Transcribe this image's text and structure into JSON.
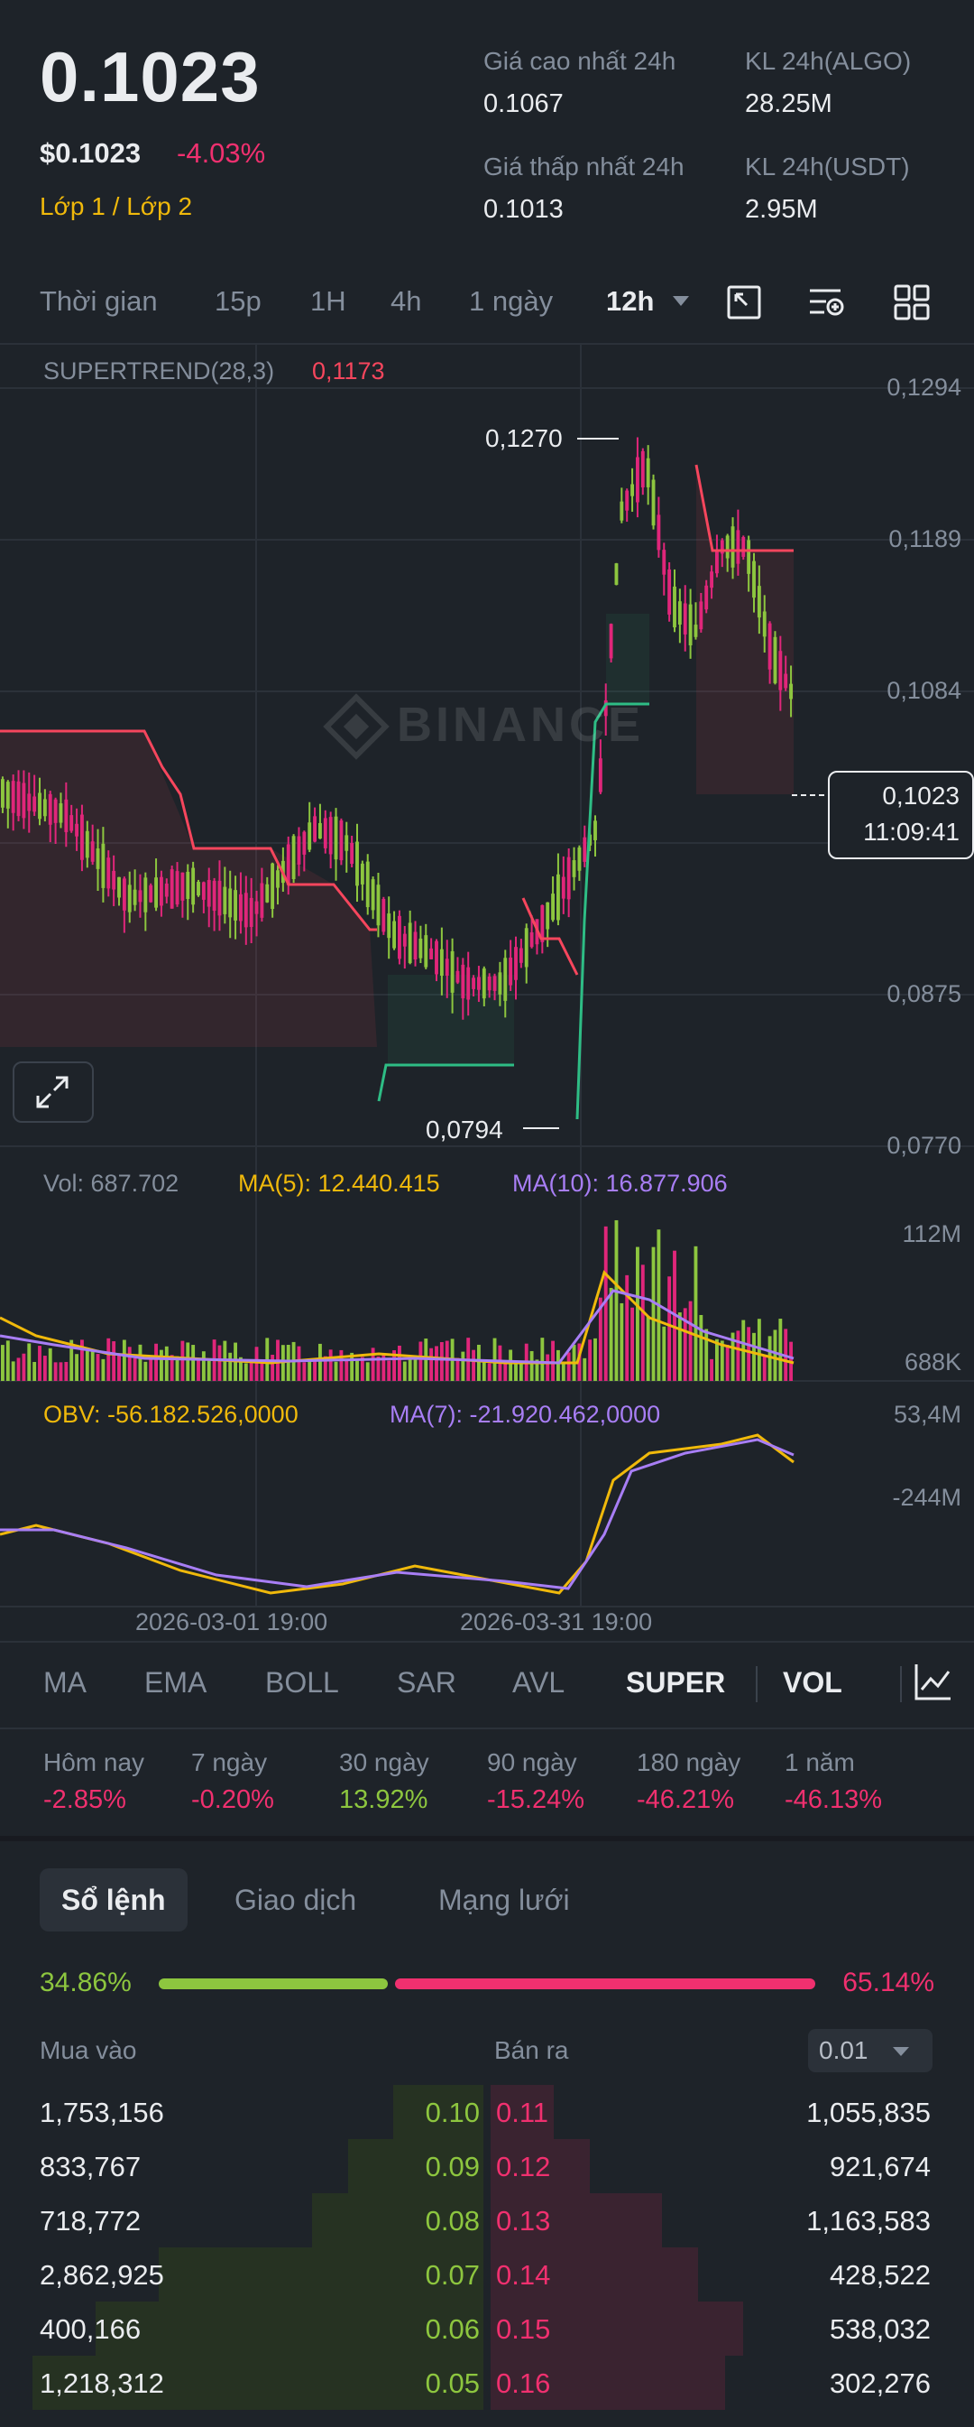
{
  "header": {
    "last_price": "0.1023",
    "usd_price": "$0.1023",
    "change_pct": "-4.03%",
    "tags": "Lớp 1 / Lớp 2",
    "stats": [
      {
        "label": "Giá cao nhất 24h",
        "value": "0.1067"
      },
      {
        "label": "KL 24h(ALGO)",
        "value": "28.25M"
      },
      {
        "label": "Giá thấp nhất 24h",
        "value": "0.1013"
      },
      {
        "label": "KL 24h(USDT)",
        "value": "2.95M"
      }
    ]
  },
  "timeframes": {
    "label": "Thời gian",
    "items": [
      "15p",
      "1H",
      "4h",
      "1 ngày",
      "12h"
    ],
    "active": "12h"
  },
  "chart": {
    "indicator_label": "SUPERTREND(28,3)",
    "indicator_value": "0,1173",
    "watermark": "BINANCE",
    "high_label": "0,1270",
    "low_label": "0,0794",
    "last_price": "0,1023",
    "countdown": "11:09:41",
    "y_ticks": [
      "0,1294",
      "0,1189",
      "0,1084",
      "0,0875",
      "0,0770"
    ],
    "colors": {
      "up": "#8dc63f",
      "down": "#e0267a",
      "trend_down": "#f6465d",
      "trend_up": "#2ebd85"
    }
  },
  "volume": {
    "vol_label": "Vol: 687.702",
    "ma5_label": "MA(5): 12.440.415",
    "ma10_label": "MA(10): 16.877.906",
    "y_ticks": [
      "112M",
      "688K"
    ]
  },
  "obv": {
    "obv_label": "OBV: -56.182.526,0000",
    "ma7_label": "MA(7): -21.920.462,0000",
    "y_ticks": [
      "53,4M",
      "-244M"
    ]
  },
  "x_ticks": [
    "2026-03-01 19:00",
    "2026-03-31 19:00"
  ],
  "indicator_tabs": [
    "MA",
    "EMA",
    "BOLL",
    "SAR",
    "AVL",
    "SUPER",
    "VOL"
  ],
  "performance": [
    {
      "label": "Hôm nay",
      "value": "-2.85%"
    },
    {
      "label": "7 ngày",
      "value": "-0.20%"
    },
    {
      "label": "30 ngày",
      "value": "13.92%"
    },
    {
      "label": "90 ngày",
      "value": "-15.24%"
    },
    {
      "label": "180 ngày",
      "value": "-46.21%"
    },
    {
      "label": "1 năm",
      "value": "-46.13%"
    }
  ],
  "orderbook": {
    "tabs": [
      "Sổ lệnh",
      "Giao dịch",
      "Mạng lưới"
    ],
    "buy_ratio": "34.86%",
    "sell_ratio": "65.14%",
    "buy_fraction": 0.3486,
    "buy_header": "Mua vào",
    "sell_header": "Bán ra",
    "precision": "0.01",
    "rows": [
      {
        "bid_qty": "1,753,156",
        "bid": "0.10",
        "ask": "0.11",
        "ask_qty": "1,055,835"
      },
      {
        "bid_qty": "833,767",
        "bid": "0.09",
        "ask": "0.12",
        "ask_qty": "921,674"
      },
      {
        "bid_qty": "718,772",
        "bid": "0.08",
        "ask": "0.13",
        "ask_qty": "1,163,583"
      },
      {
        "bid_qty": "2,862,925",
        "bid": "0.07",
        "ask": "0.14",
        "ask_qty": "428,522"
      },
      {
        "bid_qty": "400,166",
        "bid": "0.06",
        "ask": "0.15",
        "ask_qty": "538,032"
      },
      {
        "bid_qty": "1,218,312",
        "bid": "0.05",
        "ask": "0.16",
        "ask_qty": "302,276"
      }
    ]
  }
}
